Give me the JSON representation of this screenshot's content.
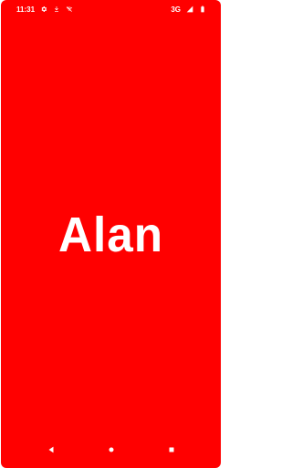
{
  "status_bar": {
    "time": "11:31",
    "network_label": "3G",
    "icons": {
      "settings": "gear-icon",
      "download": "download-icon",
      "wifi": "wifi-off-icon",
      "signal": "signal-icon",
      "battery": "battery-icon"
    }
  },
  "splash": {
    "title": "Alan"
  },
  "nav_bar": {
    "back": "back-icon",
    "home": "home-icon",
    "recents": "recents-icon"
  },
  "colors": {
    "background": "#ff0000",
    "foreground": "#ffffff",
    "frame": "#ffffff"
  }
}
